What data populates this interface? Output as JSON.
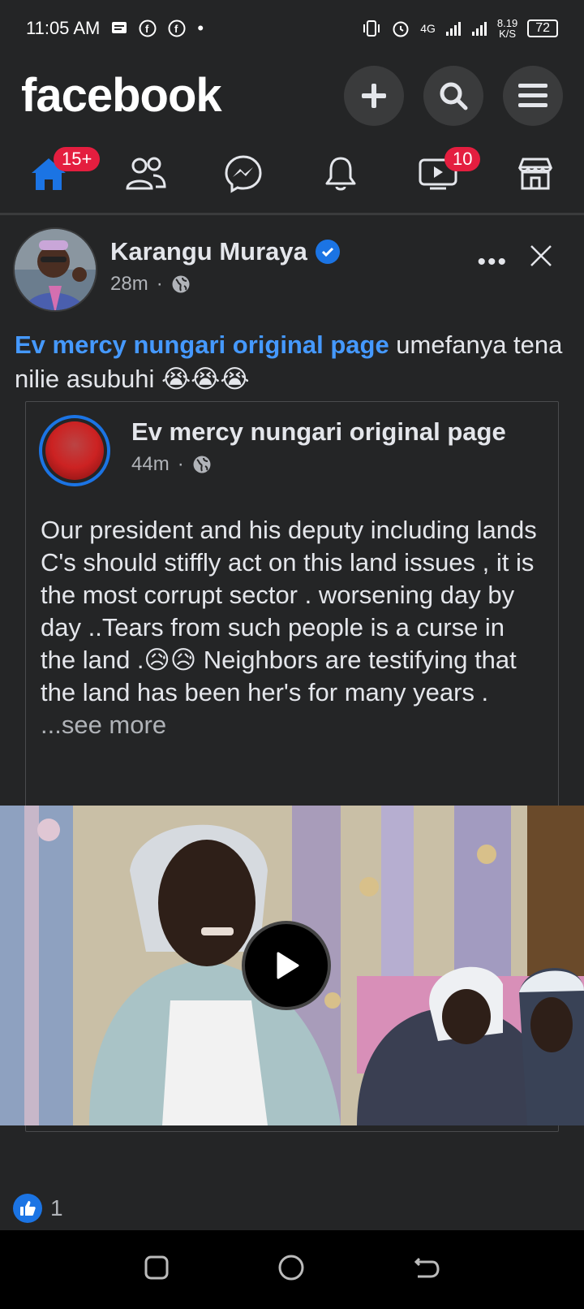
{
  "status_bar": {
    "time": "11:05 AM",
    "network": "4G",
    "speed": "8.19",
    "speed_unit": "K/S",
    "battery": "72"
  },
  "header": {
    "logo": "facebook",
    "icons": [
      "plus-icon",
      "search-icon",
      "menu-icon"
    ]
  },
  "nav": {
    "home_badge": "15+",
    "video_badge": "10",
    "items": [
      "home",
      "friends",
      "messenger",
      "notifications",
      "watch",
      "marketplace"
    ]
  },
  "post": {
    "author": "Karangu Muraya",
    "time": "28m",
    "separator": "·",
    "mention": "Ev mercy nungari original page",
    "text": " umefanya tena nilie asubuhi 😭😭😭",
    "more": "•••"
  },
  "shared_post": {
    "author": "Ev mercy nungari original page",
    "time": "44m",
    "separator": "·",
    "text": "Our president and his deputy including lands C's  should stiffly act on this land issues , it is the most corrupt sector . worsening day by day ..Tears from such people is a curse in the land .😥😥 Neighbors are testifying that the land has been her's for many years .",
    "see_more": "...see more"
  },
  "reactions": {
    "like_count": "1"
  },
  "colors": {
    "background": "#242526",
    "accent": "#1b74e4",
    "mention": "#4599ff",
    "badge": "#e41e3f"
  }
}
